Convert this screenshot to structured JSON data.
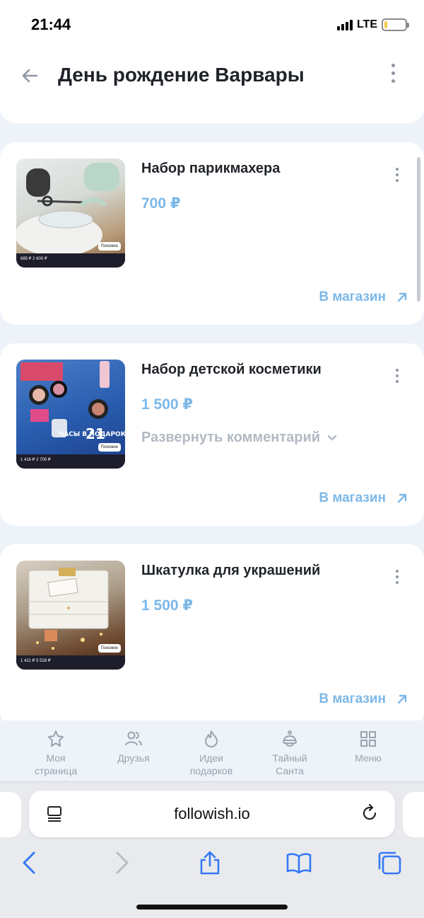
{
  "status_bar": {
    "time": "21:44",
    "network": "LTE"
  },
  "header": {
    "title": "День рождение Варвары"
  },
  "items": [
    {
      "title": "Набор парикмахера",
      "price": "700 ₽",
      "store_label": "В магазин",
      "thumb": {
        "price": "685 ₽ 2 600 ₽",
        "badge": "Похожие"
      }
    },
    {
      "title": "Набор детской косметики",
      "price": "1 500 ₽",
      "comment_toggle": "Развернуть комментарий",
      "store_label": "В магазин",
      "thumb": {
        "price": "1 416 ₽ 2 700 ₽",
        "badge": "Похожие",
        "overlay_text": "ЧАСЫ В ПОДАРОК",
        "overlay_number": "21"
      }
    },
    {
      "title": "Шкатулка для украшений",
      "price": "1 500 ₽",
      "store_label": "В магазин",
      "thumb": {
        "price": "1 421 ₽ 5 528 ₽",
        "badge": "Похожие"
      }
    }
  ],
  "bottom_nav": [
    {
      "label": "Моя страница",
      "icon": "star-icon"
    },
    {
      "label": "Друзья",
      "icon": "friends-icon"
    },
    {
      "label": "Идеи подарков",
      "icon": "flame-icon"
    },
    {
      "label": "Тайный Санта",
      "icon": "santa-icon"
    },
    {
      "label": "Меню",
      "icon": "grid-icon"
    }
  ],
  "browser": {
    "url": "followish.io"
  },
  "colors": {
    "accent": "#7cb8e8",
    "muted": "#9aa2ad",
    "title": "#1f2329"
  }
}
